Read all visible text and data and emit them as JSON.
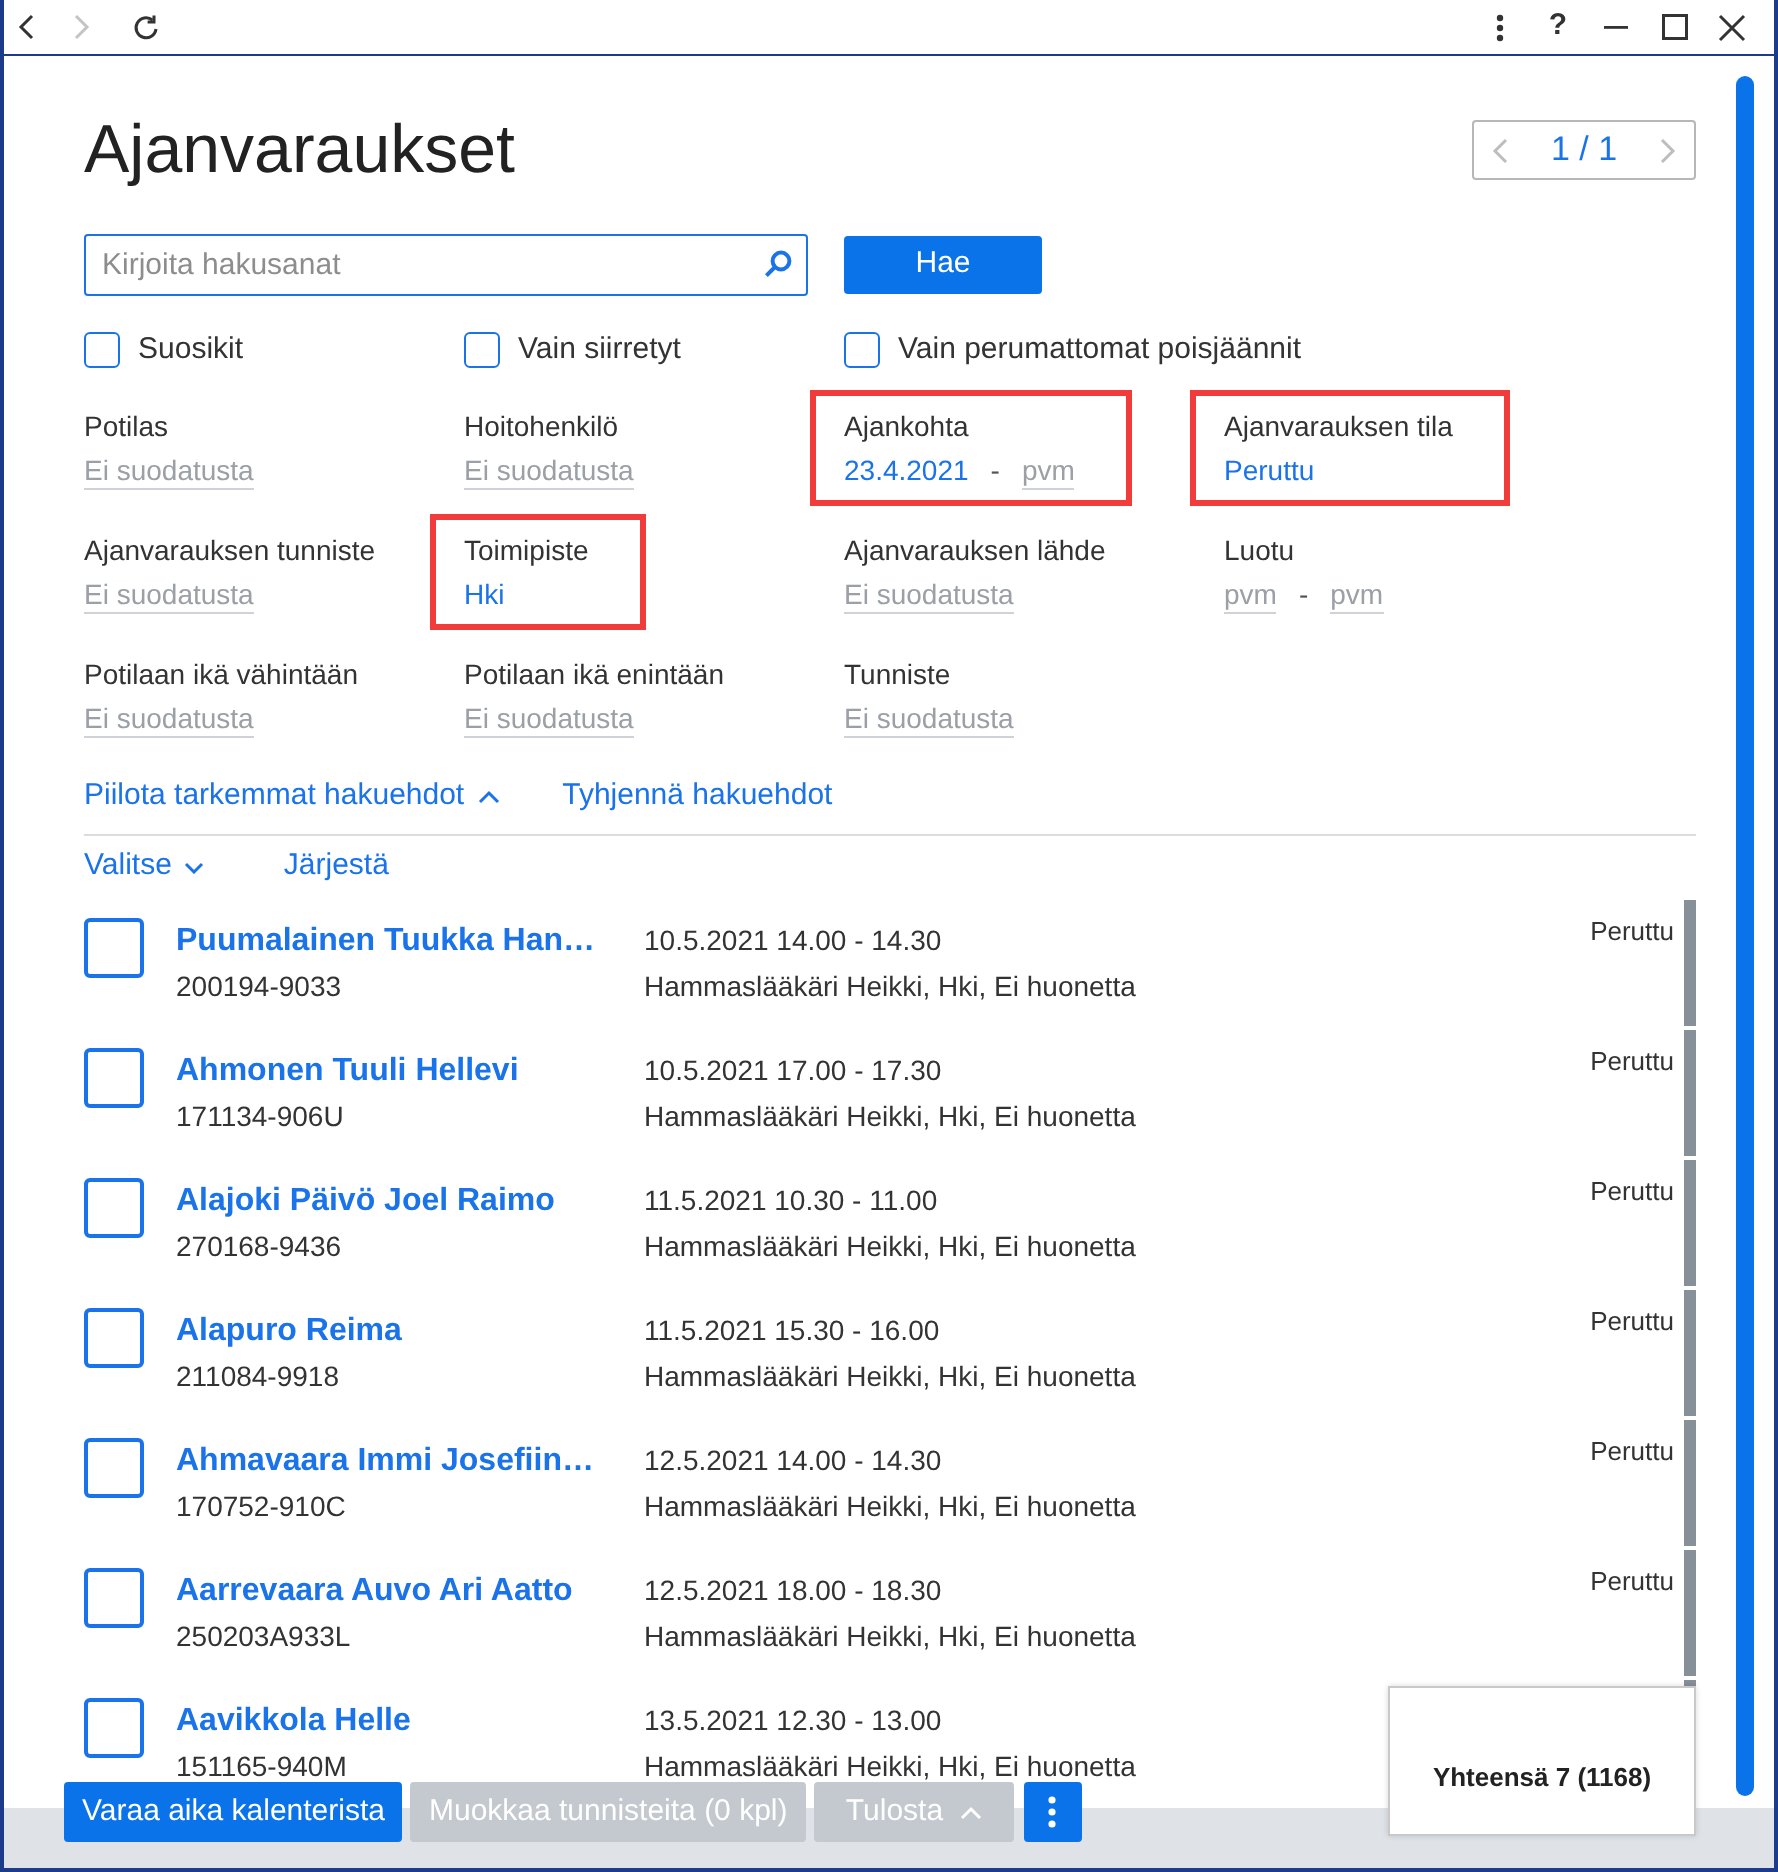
{
  "window": {
    "nav": [
      {
        "kind": "back",
        "disabled": false
      },
      {
        "kind": "forward",
        "disabled": true
      },
      {
        "kind": "refresh",
        "disabled": false
      }
    ],
    "controls": [
      {
        "kind": "more"
      },
      {
        "kind": "help",
        "text": "?"
      },
      {
        "kind": "minimize"
      },
      {
        "kind": "maximize"
      },
      {
        "kind": "close"
      }
    ]
  },
  "page": {
    "title": "Ajanvaraukset",
    "pager": {
      "text": "1 / 1",
      "prev_disabled": true,
      "next_disabled": true
    }
  },
  "search": {
    "placeholder": "Kirjoita hakusanat",
    "button": "Hae"
  },
  "options": [
    {
      "label": "Suosikit",
      "checked": false
    },
    {
      "label": "Vain siirretyt",
      "checked": false
    },
    {
      "label": "Vain perumattomat poisjäännit",
      "checked": false
    }
  ],
  "filters": [
    {
      "label": "Potilas",
      "kind": "single",
      "highlighted": false,
      "values": [
        {
          "text": "Ei suodatusta",
          "active": false
        }
      ]
    },
    {
      "label": "Hoitohenkilö",
      "kind": "single",
      "highlighted": false,
      "values": [
        {
          "text": "Ei suodatusta",
          "active": false
        }
      ]
    },
    {
      "label": "Ajankohta",
      "kind": "range",
      "highlighted": true,
      "separator": "-",
      "values": [
        {
          "text": "23.4.2021",
          "active": true
        },
        {
          "text": "pvm",
          "active": false
        }
      ]
    },
    {
      "label": "Ajanvarauksen tila",
      "kind": "single",
      "highlighted": true,
      "values": [
        {
          "text": "Peruttu",
          "active": true
        }
      ]
    },
    {
      "label": "Ajanvarauksen tunniste",
      "kind": "single",
      "highlighted": false,
      "values": [
        {
          "text": "Ei suodatusta",
          "active": false
        }
      ]
    },
    {
      "label": "Toimipiste",
      "kind": "single",
      "highlighted": true,
      "values": [
        {
          "text": "Hki",
          "active": true
        }
      ]
    },
    {
      "label": "Ajanvarauksen lähde",
      "kind": "single",
      "highlighted": false,
      "values": [
        {
          "text": "Ei suodatusta",
          "active": false
        }
      ]
    },
    {
      "label": "Luotu",
      "kind": "range",
      "highlighted": false,
      "separator": "-",
      "values": [
        {
          "text": "pvm",
          "active": false
        },
        {
          "text": "pvm",
          "active": false
        }
      ]
    },
    {
      "label": "Potilaan ikä vähintään",
      "kind": "single",
      "highlighted": false,
      "values": [
        {
          "text": "Ei suodatusta",
          "active": false
        }
      ]
    },
    {
      "label": "Potilaan ikä enintään",
      "kind": "single",
      "highlighted": false,
      "values": [
        {
          "text": "Ei suodatusta",
          "active": false
        }
      ]
    },
    {
      "label": "Tunniste",
      "kind": "single",
      "highlighted": false,
      "values": [
        {
          "text": "Ei suodatusta",
          "active": false
        }
      ]
    }
  ],
  "filter_links": {
    "toggle": "Piilota tarkemmat hakuehdot",
    "expanded": true,
    "clear": "Tyhjennä hakuehdot"
  },
  "list_toolbar": {
    "select": "Valitse",
    "sort": "Järjestä"
  },
  "appointments": [
    {
      "name": "Puumalainen Tuukka Han…",
      "id": "200194-9033",
      "time": "10.5.2021 14.00 - 14.30",
      "place": "Hammaslääkäri Heikki, Hki, Ei huonetta",
      "status": "Peruttu",
      "selected": false
    },
    {
      "name": "Ahmonen Tuuli Hellevi",
      "id": "171134-906U",
      "time": "10.5.2021 17.00 - 17.30",
      "place": "Hammaslääkäri Heikki, Hki, Ei huonetta",
      "status": "Peruttu",
      "selected": false
    },
    {
      "name": "Alajoki Päivö Joel Raimo",
      "id": "270168-9436",
      "time": "11.5.2021 10.30 - 11.00",
      "place": "Hammaslääkäri Heikki, Hki, Ei huonetta",
      "status": "Peruttu",
      "selected": false
    },
    {
      "name": "Alapuro Reima",
      "id": "211084-9918",
      "time": "11.5.2021 15.30 - 16.00",
      "place": "Hammaslääkäri Heikki, Hki, Ei huonetta",
      "status": "Peruttu",
      "selected": false
    },
    {
      "name": "Ahmavaara Immi Josefiin…",
      "id": "170752-910C",
      "time": "12.5.2021 14.00 - 14.30",
      "place": "Hammaslääkäri Heikki, Hki, Ei huonetta",
      "status": "Peruttu",
      "selected": false
    },
    {
      "name": "Aarrevaara Auvo Ari Aatto",
      "id": "250203A933L",
      "time": "12.5.2021 18.00 - 18.30",
      "place": "Hammaslääkäri Heikki, Hki, Ei huonetta",
      "status": "Peruttu",
      "selected": false
    },
    {
      "name": "Aavikkola Helle",
      "id": "151165-940M",
      "time": "13.5.2021 12.30 - 13.00",
      "place": "Hammaslääkäri Heikki, Hki, Ei huonetta",
      "selected": false
    }
  ],
  "footer": {
    "buttons": [
      {
        "kind": "text",
        "label": "Varaa aika kalenterista",
        "disabled": false
      },
      {
        "kind": "text",
        "label": "Muokkaa tunnisteita (0 kpl)",
        "disabled": true
      },
      {
        "kind": "dropdown",
        "label": "Tulosta",
        "disabled": true
      },
      {
        "kind": "icon",
        "disabled": false
      }
    ],
    "total": "Yhteensä 7 (1168)"
  }
}
